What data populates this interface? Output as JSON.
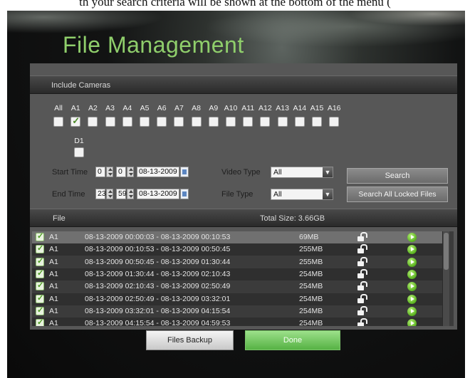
{
  "caption": "th your search criteria will be shown at the bottom of the menu (",
  "title": "File Management",
  "include_cameras": {
    "header": "Include Cameras",
    "cameras": [
      {
        "label": "All",
        "checked": false
      },
      {
        "label": "A1",
        "checked": true
      },
      {
        "label": "A2",
        "checked": false
      },
      {
        "label": "A3",
        "checked": false
      },
      {
        "label": "A4",
        "checked": false
      },
      {
        "label": "A5",
        "checked": false
      },
      {
        "label": "A6",
        "checked": false
      },
      {
        "label": "A7",
        "checked": false
      },
      {
        "label": "A8",
        "checked": false
      },
      {
        "label": "A9",
        "checked": false
      },
      {
        "label": "A10",
        "checked": false
      },
      {
        "label": "A11",
        "checked": false
      },
      {
        "label": "A12",
        "checked": false
      },
      {
        "label": "A13",
        "checked": false
      },
      {
        "label": "A14",
        "checked": false
      },
      {
        "label": "A15",
        "checked": false
      },
      {
        "label": "A16",
        "checked": false
      }
    ],
    "extra_camera": {
      "label": "D1",
      "checked": false
    }
  },
  "search": {
    "start_time_label": "Start Time",
    "start_hour": "0",
    "start_minute": "0",
    "start_date": "08-13-2009",
    "end_time_label": "End Time",
    "end_hour": "23",
    "end_minute": "59",
    "end_date": "08-13-2009",
    "video_type_label": "Video Type",
    "video_type_value": "All",
    "file_type_label": "File Type",
    "file_type_value": "All",
    "search_button": "Search",
    "search_locked_button": "Search All Locked Files"
  },
  "files": {
    "header": "File",
    "total_size": "Total Size: 3.66GB",
    "rows": [
      {
        "camera": "A1",
        "range": "08-13-2009 00:00:03 - 08-13-2009 00:10:53",
        "size": "69MB"
      },
      {
        "camera": "A1",
        "range": "08-13-2009 00:10:53 - 08-13-2009 00:50:45",
        "size": "255MB"
      },
      {
        "camera": "A1",
        "range": "08-13-2009 00:50:45 - 08-13-2009 01:30:44",
        "size": "255MB"
      },
      {
        "camera": "A1",
        "range": "08-13-2009 01:30:44 - 08-13-2009 02:10:43",
        "size": "254MB"
      },
      {
        "camera": "A1",
        "range": "08-13-2009 02:10:43 - 08-13-2009 02:50:49",
        "size": "254MB"
      },
      {
        "camera": "A1",
        "range": "08-13-2009 02:50:49 - 08-13-2009 03:32:01",
        "size": "254MB"
      },
      {
        "camera": "A1",
        "range": "08-13-2009 03:32:01 - 08-13-2009 04:15:54",
        "size": "254MB"
      },
      {
        "camera": "A1",
        "range": "08-13-2009 04:15:54 - 08-13-2009 04:59:53",
        "size": "254MB"
      }
    ]
  },
  "buttons": {
    "backup": "Files Backup",
    "done": "Done"
  },
  "colors": {
    "title_green": "#8fce6b",
    "done_green": "#6cc25a",
    "panel_gray": "#575757"
  }
}
